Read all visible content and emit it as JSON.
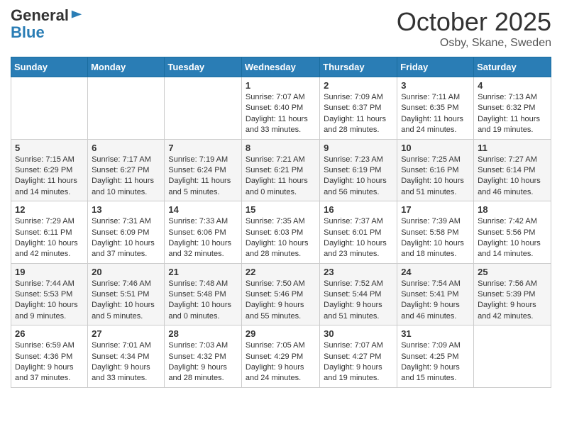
{
  "header": {
    "logo_general": "General",
    "logo_blue": "Blue",
    "month_title": "October 2025",
    "location": "Osby, Skane, Sweden"
  },
  "days_of_week": [
    "Sunday",
    "Monday",
    "Tuesday",
    "Wednesday",
    "Thursday",
    "Friday",
    "Saturday"
  ],
  "weeks": [
    [
      {
        "day": "",
        "info": ""
      },
      {
        "day": "",
        "info": ""
      },
      {
        "day": "",
        "info": ""
      },
      {
        "day": "1",
        "info": "Sunrise: 7:07 AM\nSunset: 6:40 PM\nDaylight: 11 hours and 33 minutes."
      },
      {
        "day": "2",
        "info": "Sunrise: 7:09 AM\nSunset: 6:37 PM\nDaylight: 11 hours and 28 minutes."
      },
      {
        "day": "3",
        "info": "Sunrise: 7:11 AM\nSunset: 6:35 PM\nDaylight: 11 hours and 24 minutes."
      },
      {
        "day": "4",
        "info": "Sunrise: 7:13 AM\nSunset: 6:32 PM\nDaylight: 11 hours and 19 minutes."
      }
    ],
    [
      {
        "day": "5",
        "info": "Sunrise: 7:15 AM\nSunset: 6:29 PM\nDaylight: 11 hours and 14 minutes."
      },
      {
        "day": "6",
        "info": "Sunrise: 7:17 AM\nSunset: 6:27 PM\nDaylight: 11 hours and 10 minutes."
      },
      {
        "day": "7",
        "info": "Sunrise: 7:19 AM\nSunset: 6:24 PM\nDaylight: 11 hours and 5 minutes."
      },
      {
        "day": "8",
        "info": "Sunrise: 7:21 AM\nSunset: 6:21 PM\nDaylight: 11 hours and 0 minutes."
      },
      {
        "day": "9",
        "info": "Sunrise: 7:23 AM\nSunset: 6:19 PM\nDaylight: 10 hours and 56 minutes."
      },
      {
        "day": "10",
        "info": "Sunrise: 7:25 AM\nSunset: 6:16 PM\nDaylight: 10 hours and 51 minutes."
      },
      {
        "day": "11",
        "info": "Sunrise: 7:27 AM\nSunset: 6:14 PM\nDaylight: 10 hours and 46 minutes."
      }
    ],
    [
      {
        "day": "12",
        "info": "Sunrise: 7:29 AM\nSunset: 6:11 PM\nDaylight: 10 hours and 42 minutes."
      },
      {
        "day": "13",
        "info": "Sunrise: 7:31 AM\nSunset: 6:09 PM\nDaylight: 10 hours and 37 minutes."
      },
      {
        "day": "14",
        "info": "Sunrise: 7:33 AM\nSunset: 6:06 PM\nDaylight: 10 hours and 32 minutes."
      },
      {
        "day": "15",
        "info": "Sunrise: 7:35 AM\nSunset: 6:03 PM\nDaylight: 10 hours and 28 minutes."
      },
      {
        "day": "16",
        "info": "Sunrise: 7:37 AM\nSunset: 6:01 PM\nDaylight: 10 hours and 23 minutes."
      },
      {
        "day": "17",
        "info": "Sunrise: 7:39 AM\nSunset: 5:58 PM\nDaylight: 10 hours and 18 minutes."
      },
      {
        "day": "18",
        "info": "Sunrise: 7:42 AM\nSunset: 5:56 PM\nDaylight: 10 hours and 14 minutes."
      }
    ],
    [
      {
        "day": "19",
        "info": "Sunrise: 7:44 AM\nSunset: 5:53 PM\nDaylight: 10 hours and 9 minutes."
      },
      {
        "day": "20",
        "info": "Sunrise: 7:46 AM\nSunset: 5:51 PM\nDaylight: 10 hours and 5 minutes."
      },
      {
        "day": "21",
        "info": "Sunrise: 7:48 AM\nSunset: 5:48 PM\nDaylight: 10 hours and 0 minutes."
      },
      {
        "day": "22",
        "info": "Sunrise: 7:50 AM\nSunset: 5:46 PM\nDaylight: 9 hours and 55 minutes."
      },
      {
        "day": "23",
        "info": "Sunrise: 7:52 AM\nSunset: 5:44 PM\nDaylight: 9 hours and 51 minutes."
      },
      {
        "day": "24",
        "info": "Sunrise: 7:54 AM\nSunset: 5:41 PM\nDaylight: 9 hours and 46 minutes."
      },
      {
        "day": "25",
        "info": "Sunrise: 7:56 AM\nSunset: 5:39 PM\nDaylight: 9 hours and 42 minutes."
      }
    ],
    [
      {
        "day": "26",
        "info": "Sunrise: 6:59 AM\nSunset: 4:36 PM\nDaylight: 9 hours and 37 minutes."
      },
      {
        "day": "27",
        "info": "Sunrise: 7:01 AM\nSunset: 4:34 PM\nDaylight: 9 hours and 33 minutes."
      },
      {
        "day": "28",
        "info": "Sunrise: 7:03 AM\nSunset: 4:32 PM\nDaylight: 9 hours and 28 minutes."
      },
      {
        "day": "29",
        "info": "Sunrise: 7:05 AM\nSunset: 4:29 PM\nDaylight: 9 hours and 24 minutes."
      },
      {
        "day": "30",
        "info": "Sunrise: 7:07 AM\nSunset: 4:27 PM\nDaylight: 9 hours and 19 minutes."
      },
      {
        "day": "31",
        "info": "Sunrise: 7:09 AM\nSunset: 4:25 PM\nDaylight: 9 hours and 15 minutes."
      },
      {
        "day": "",
        "info": ""
      }
    ]
  ]
}
